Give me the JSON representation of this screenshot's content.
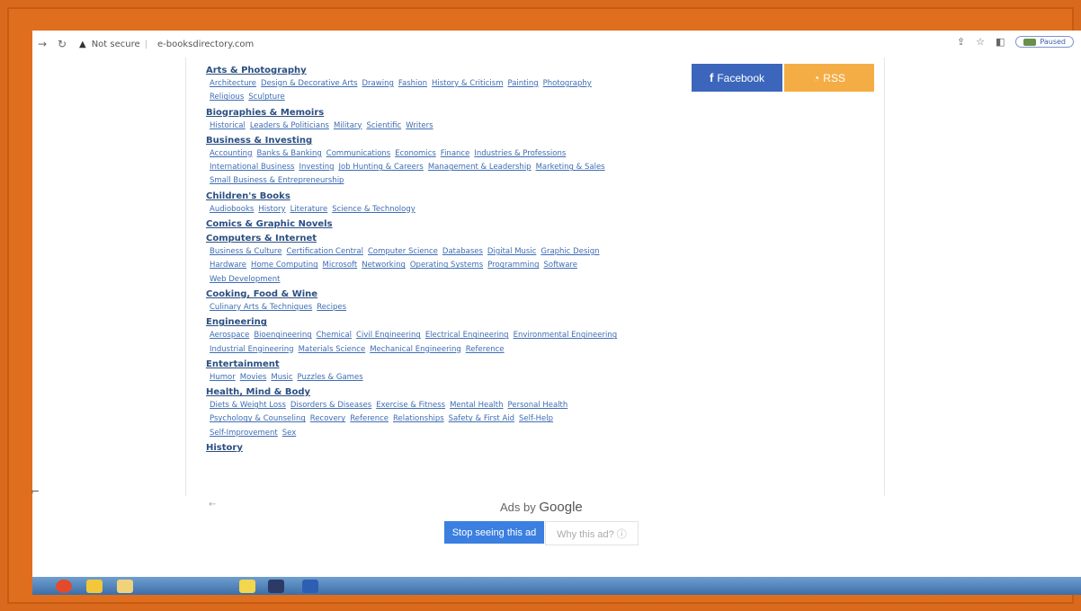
{
  "browser": {
    "security_label": "Not secure",
    "url": "e-booksdirectory.com",
    "profile_status": "Paused"
  },
  "social": {
    "facebook_label": "Facebook",
    "rss_label": "RSS"
  },
  "categories": [
    {
      "title": "Arts & Photography",
      "lines": [
        [
          "Architecture",
          "Design & Decorative Arts",
          "Drawing",
          "Fashion",
          "History & Criticism",
          "Painting",
          "Photography"
        ],
        [
          "Religious",
          "Sculpture"
        ]
      ]
    },
    {
      "title": "Biographies & Memoirs",
      "lines": [
        [
          "Historical",
          "Leaders & Politicians",
          "Military",
          "Scientific",
          "Writers"
        ]
      ]
    },
    {
      "title": "Business & Investing",
      "lines": [
        [
          "Accounting",
          "Banks & Banking",
          "Communications",
          "Economics",
          "Finance",
          "Industries & Professions"
        ],
        [
          "International Business",
          "Investing",
          "Job Hunting & Careers",
          "Management & Leadership",
          "Marketing & Sales"
        ],
        [
          "Small Business & Entrepreneurship"
        ]
      ]
    },
    {
      "title": "Children's Books",
      "lines": [
        [
          "Audiobooks",
          "History",
          "Literature",
          "Science & Technology"
        ]
      ]
    },
    {
      "title": "Comics & Graphic Novels",
      "lines": []
    },
    {
      "title": "Computers & Internet",
      "lines": [
        [
          "Business & Culture",
          "Certification Central",
          "Computer Science",
          "Databases",
          "Digital Music",
          "Graphic Design"
        ],
        [
          "Hardware",
          "Home Computing",
          "Microsoft",
          "Networking",
          "Operating Systems",
          "Programming",
          "Software"
        ],
        [
          "Web Development"
        ]
      ]
    },
    {
      "title": "Cooking, Food & Wine",
      "lines": [
        [
          "Culinary Arts & Techniques",
          "Recipes"
        ]
      ]
    },
    {
      "title": "Engineering",
      "lines": [
        [
          "Aerospace",
          "Bioengineering",
          "Chemical",
          "Civil Engineering",
          "Electrical Engineering",
          "Environmental Engineering"
        ],
        [
          "Industrial Engineering",
          "Materials Science",
          "Mechanical Engineering",
          "Reference"
        ]
      ]
    },
    {
      "title": "Entertainment",
      "lines": [
        [
          "Humor",
          "Movies",
          "Music",
          "Puzzles & Games"
        ]
      ]
    },
    {
      "title": "Health, Mind & Body",
      "lines": [
        [
          "Diets & Weight Loss",
          "Disorders & Diseases",
          "Exercise & Fitness",
          "Mental Health",
          "Personal Health"
        ],
        [
          "Psychology & Counseling",
          "Recovery",
          "Reference",
          "Relationships",
          "Safety & First Aid",
          "Self-Help"
        ],
        [
          "Self-Improvement",
          "Sex"
        ]
      ]
    },
    {
      "title": "History",
      "lines": []
    }
  ],
  "ad": {
    "ads_by": "Ads by",
    "google": "Google",
    "stop_label": "Stop seeing this ad",
    "why_label": "Why this ad? ⓘ"
  },
  "colors": {
    "frame": "#e06e1f",
    "link": "#3d6db4",
    "facebook": "#3b66bb",
    "rss": "#f4ad45",
    "stop_button": "#3b7fe0"
  }
}
